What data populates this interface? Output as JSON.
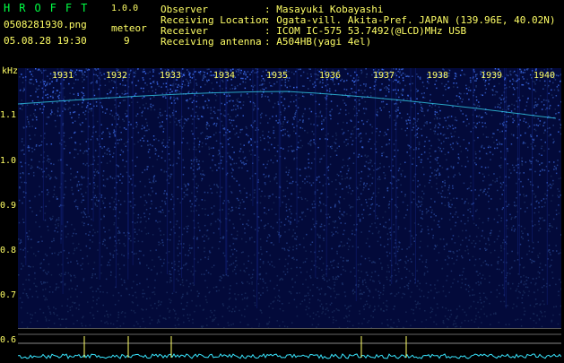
{
  "header": {
    "app_name": "HROFFT",
    "version": "1.0.0",
    "filename": "0508281930.png",
    "datetime": "05.08.28 19:30",
    "meteor_label": "meteor",
    "meteor_count": "9"
  },
  "info": {
    "rows": [
      {
        "label": "Observer",
        "value": ": Masayuki Kobayashi"
      },
      {
        "label": "Receiving Location",
        "value": ": Ogata-vill. Akita-Pref. JAPAN (139.96E, 40.02N)"
      },
      {
        "label": "Receiver",
        "value": ": ICOM IC-575 53.7492(@LCD)MHz USB"
      },
      {
        "label": "Receiving antenna",
        "value": ": A504HB(yagi 4el)"
      }
    ]
  },
  "axes": {
    "y_unit": "kHz",
    "y_ticks": [
      "1.1",
      "1.0",
      "0.9",
      "0.8",
      "0.7",
      "0.6"
    ],
    "x_ticks": [
      "1931",
      "1932",
      "1933",
      "1934",
      "1935",
      "1936",
      "1937",
      "1938",
      "1939",
      "1940"
    ]
  },
  "colors": {
    "background": "#000000",
    "spectrum_bg": "#030a3a",
    "text": "#ffff66",
    "brand": "#00ff44",
    "signal": "#39e6ff"
  }
}
